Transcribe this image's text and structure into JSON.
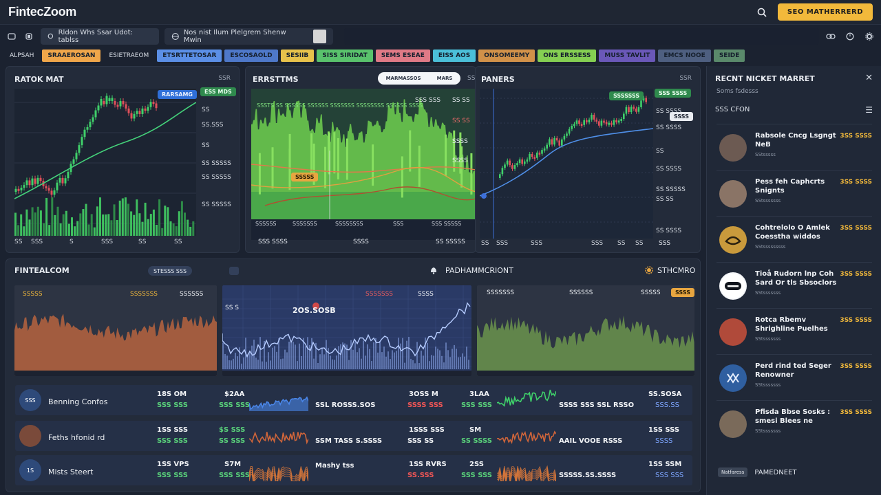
{
  "header": {
    "logo": "FintecZoom",
    "cta_label": "SEO MATHERRERD"
  },
  "browser": {
    "tab1": "Rldon Whs Ssar Udot: tablss",
    "tab2": "Nos nist Ilum Plelgrem Shenw Mwin"
  },
  "ticker": [
    {
      "label": "ALPSAH",
      "color": ""
    },
    {
      "label": "SRAAEROSAN",
      "color": "#f0a64a"
    },
    {
      "label": "ESIETRAEOM",
      "color": ""
    },
    {
      "label": "ETSRTTETOSAR",
      "color": "#5b8fe6"
    },
    {
      "label": "ESCOSAOLD",
      "color": "#4e78c9"
    },
    {
      "label": "SESIIB",
      "color": "#e7c24b"
    },
    {
      "label": "SISS SIRIDAT",
      "color": "#59c26c"
    },
    {
      "label": "SEMS ESEAE",
      "color": "#e07a86"
    },
    {
      "label": "EISS AOS",
      "color": "#4bbfd8"
    },
    {
      "label": "ONSOMEEMY",
      "color": "#d19149"
    },
    {
      "label": "ONS ERSSESS",
      "color": "#85cf52"
    },
    {
      "label": "MUSS TAVLIT",
      "color": "#6a58b8"
    },
    {
      "label": "EMCS NOOE",
      "color": "#4e5f80"
    },
    {
      "label": "SEIDE",
      "color": "#5a8a6b"
    }
  ],
  "panel1": {
    "title": "RATOK MAT",
    "corner": "SSR",
    "badge_top": "RARSAMG",
    "badge_side": "ESS MDS",
    "yticks": [
      "SS",
      "SS.SSS",
      "SS",
      "SS SSSSS",
      "SS SSSSS",
      "SS SSSSS"
    ],
    "xticks": [
      "SS",
      "SSS",
      "S",
      "SSS",
      "SS",
      "SS"
    ]
  },
  "panel2": {
    "title": "ERRSTTMS",
    "toggle_a": "MARMASSOS",
    "toggle_b": "MARS",
    "toggle_c": "SS",
    "inner_label": "SSS SSS",
    "price_tag": "SSSSS",
    "legend": "SSSTS SS SSSSSS SSSSSS SSSSSSS SSSSSSSS SSSSSS SSSS",
    "rticks": [
      "SS SS",
      "SS SS",
      "SSSS",
      "SSSS"
    ],
    "bticks": [
      "SSSSSS",
      "SSSSSSS",
      "SSSSSSSS",
      "SSS",
      "SSS SSSSS"
    ],
    "bottom_left": "SSS SSSS",
    "bottom_mid": "SSSS",
    "bottom_right": "SS SSSSS"
  },
  "panel3": {
    "title": "PANERS",
    "corner": "SSR",
    "badge_top": "SSSSSSS",
    "badge_side": "SSS SSSS",
    "badge_dark": "SSSS",
    "yticks": [
      "SS SSSS",
      "SS SSSS",
      "SS",
      "SS SSSS",
      "SS SSSSS",
      "SS SS",
      "SS SSSS"
    ],
    "xticks": [
      "SS",
      "SSS",
      "SSS",
      "SSS",
      "SS",
      "SS"
    ],
    "corner_bottom": "SSS"
  },
  "lower": {
    "title": "FINTEALCOM",
    "pill": "STESSS SSS",
    "center_title": "PADHAMMCRIONT",
    "right_title": "STHCMRO",
    "chart_a": {
      "h1": "SSSSS",
      "h2": "SSSSSSS",
      "h3": "SSSSSS"
    },
    "chart_b": {
      "h1": "SSSSSSS",
      "h2": "SSSS",
      "yl1": "SS S",
      "price": "2OS.SOSB"
    },
    "chart_c": {
      "h1": "SSSSSSS",
      "h2": "SSSSSS",
      "h3": "SSSSS",
      "tag": "SSSS"
    }
  },
  "sidebar": {
    "title": "RECNT NICKET MARRET",
    "sub": "Soms fsdesss",
    "heading": "SSS CFON",
    "items": [
      {
        "headline": "Rabsole Cncg Lsgngt NeB",
        "source": "SStsssss",
        "value": "3SS SSSS"
      },
      {
        "headline": "Pess feh Caphcrts Snignts",
        "source": "SStsssssss",
        "value": "3SS SSSS"
      },
      {
        "headline": "Cohtrelolo O Amlek Coesstha widdos",
        "source": "SStsssssssss",
        "value": "3SS SSSS"
      },
      {
        "headline": "Tioå Rudorn  lnp Coh Sard Or tls Sbsoclors",
        "source": "SStsssssss",
        "value": "3SS SSSS"
      },
      {
        "headline": "Rotca Rbemv Shrighline Puelhes",
        "source": "SStsssssss",
        "value": "3SS SSSS"
      },
      {
        "headline": "Perd rind ted Seger Renowner",
        "source": "SStsssssss",
        "value": "3SS SSSS"
      },
      {
        "headline": "Pfisda Bbse Sosks : smesi Blees ne",
        "source": "SStsssssss",
        "value": "3SS SSSS"
      }
    ],
    "foot_pill": "Natfaress",
    "foot_label": "PAMEDNEET"
  },
  "rows": [
    {
      "name": "Benning Confos",
      "icon_text": "SSS",
      "c1a": "18S OM",
      "c1b": "SSS SSS",
      "c2a": "$2AA",
      "c2b": "SSS SSS",
      "c3": "SSL ROSSS.SOS",
      "c4a": "3OSS M",
      "c4b": "SSSS SSS",
      "c5a": "3LAA",
      "c5b": "SSS SSS",
      "c6": "SSSS SSS SSL RSSO",
      "c7a": "SS.SOSA",
      "c7b": "SSS.SS"
    },
    {
      "name": "Feths hfonid rd",
      "icon_text": "",
      "c1a": "1SS SSS",
      "c1b": "SSS SSS",
      "c2a": "$S SSS",
      "c2b": "SS SSS",
      "c3": "SSM TASS S.SSSS",
      "c4a": "1SSS SSS",
      "c4b": "SSS SS",
      "c5a": "SM",
      "c5b": "SS SSSS",
      "c6": "AAIL VOOE RSSS",
      "c7a": "1SS SSS",
      "c7b": "SSSS"
    },
    {
      "name": "Mists Steert",
      "icon_text": "1S",
      "c1a": "1SS VPS",
      "c1b": "SSS SSS",
      "c2a": "S7M",
      "c2b": "SSS SSS",
      "c3": "Mashy tss",
      "c4a": "1SS RVRS",
      "c4b": "SS.SSS",
      "c5a": "2SS",
      "c5b": "SSS SSS",
      "c6": "SSSSS.SS.SSSS",
      "c7a": "1SS SSM",
      "c7b": "SSS SSS"
    }
  ],
  "colors": {
    "accent": "#f2b93b",
    "up": "#59d07a",
    "down": "#ef5555",
    "panel": "#232b3a",
    "background": "#1b2230"
  }
}
